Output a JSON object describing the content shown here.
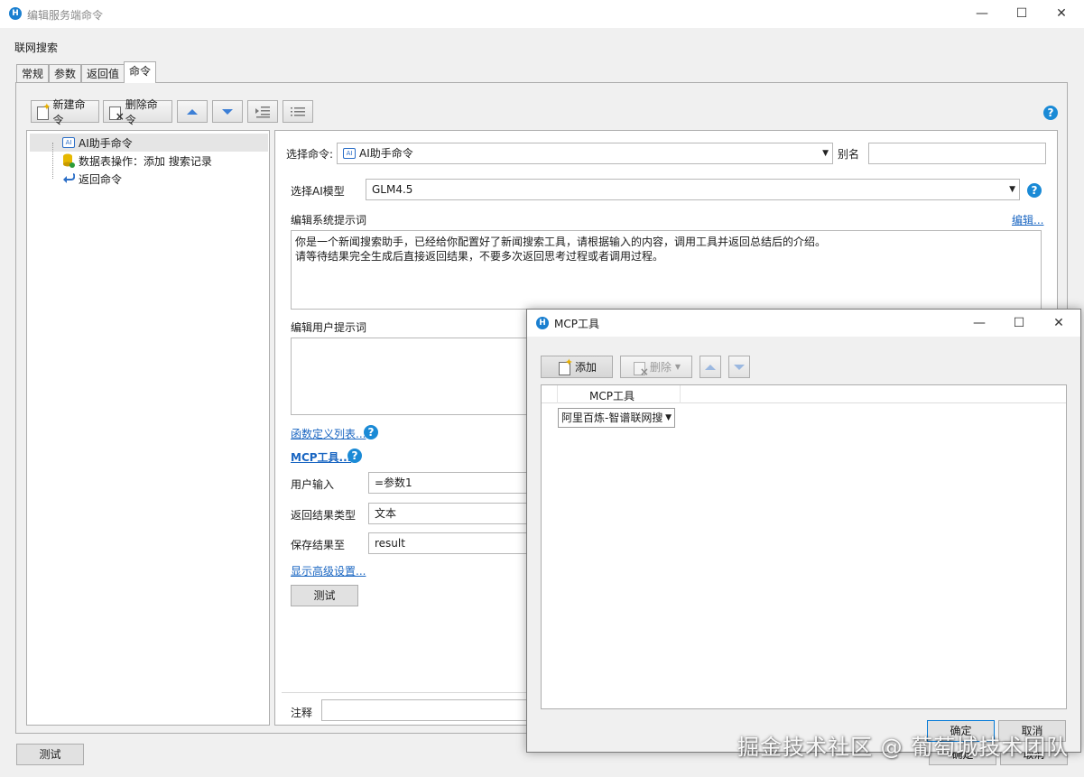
{
  "window": {
    "title": "编辑服务端命令",
    "app_icon": "H",
    "command_name": "联网搜索",
    "controls": {
      "minimize": "—",
      "maximize": "☐",
      "close": "✕"
    }
  },
  "tabs": [
    {
      "label": "常规"
    },
    {
      "label": "参数"
    },
    {
      "label": "返回值"
    },
    {
      "label": "命令"
    }
  ],
  "toolbar": {
    "new_command": "新建命令",
    "delete_command": "删除命令",
    "help": "?"
  },
  "tree": [
    {
      "label": "AI助手命令",
      "icon": "ai-command-icon"
    },
    {
      "label": "数据表操作：添加 搜索记录",
      "icon": "database-icon"
    },
    {
      "label": "返回命令",
      "icon": "return-arrow-icon"
    }
  ],
  "form": {
    "select_command_label": "选择命令:",
    "select_command_value": "AI助手命令",
    "alias_label": "别名",
    "alias_value": "",
    "ai_model_label": "选择AI模型",
    "ai_model_value": "GLM4.5",
    "system_prompt_label": "编辑系统提示词",
    "edit_link": "编辑...",
    "system_prompt_line1": "你是一个新闻搜索助手，已经给你配置好了新闻搜索工具，请根据输入的内容，调用工具并返回总结后的介绍。",
    "system_prompt_line2": "请等待结果完全生成后直接返回结果，不要多次返回思考过程或者调用过程。",
    "user_prompt_label": "编辑用户提示词",
    "user_prompt_value": "",
    "function_list_link": "函数定义列表...",
    "mcp_tools_link": "MCP工具...",
    "user_input_label": "用户输入",
    "user_input_value": "=参数1",
    "return_type_label": "返回结果类型",
    "return_type_value": "文本",
    "save_result_label": "保存结果至",
    "save_result_value": "result",
    "advanced_link": "显示高级设置...",
    "test_button": "测试",
    "comment_label": "注释"
  },
  "bottom": {
    "test_button": "测试",
    "ok_button": "确定",
    "cancel_button": "取消"
  },
  "mcp_dialog": {
    "title": "MCP工具",
    "add_button": "添加",
    "delete_button": "删除",
    "column_header": "MCP工具",
    "row_value": "阿里百炼-智谱联网搜",
    "ok_button": "确定",
    "cancel_button": "取消"
  },
  "watermark": "掘金技术社区 @ 葡萄城技术团队"
}
